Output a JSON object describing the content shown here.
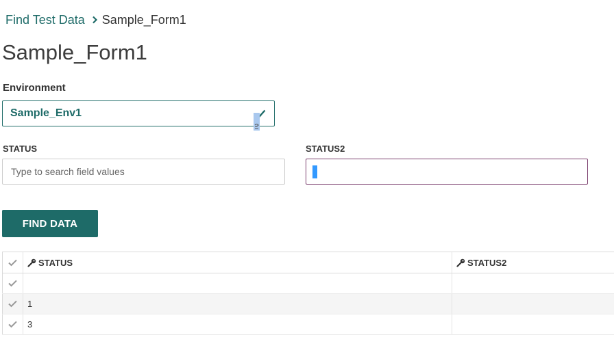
{
  "breadcrumb": {
    "parent": "Find Test Data",
    "current": "Sample_Form1"
  },
  "page": {
    "title": "Sample_Form1"
  },
  "environment": {
    "label": "Environment",
    "selected": "Sample_Env1"
  },
  "fields": {
    "status": {
      "label": "STATUS",
      "placeholder": "Type to search field values",
      "value": ""
    },
    "status2": {
      "label": "STATUS2",
      "placeholder": "",
      "value": ""
    }
  },
  "actions": {
    "find_label": "FIND DATA"
  },
  "table": {
    "columns": [
      "STATUS",
      "STATUS2"
    ],
    "rows": [
      {
        "status": "",
        "status2": ""
      },
      {
        "status": "1",
        "status2": ""
      },
      {
        "status": "3",
        "status2": ""
      }
    ]
  },
  "icons": {
    "breadcrumb_separator": "chevron-right-icon",
    "environment_check": "check-icon",
    "column_key": "key-icon",
    "row_select": "check-icon"
  },
  "colors": {
    "accent": "#1e6b68",
    "focus_border": "#7b3f6e",
    "caret": "#3399ff"
  }
}
